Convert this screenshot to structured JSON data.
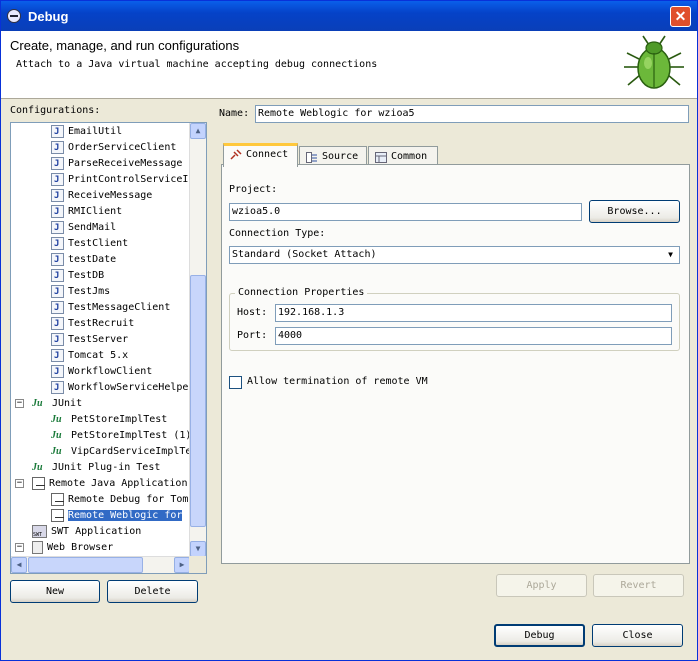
{
  "window": {
    "title": "Debug",
    "close_glyph": "✕"
  },
  "header": {
    "title": "Create, manage, and run configurations",
    "description": "Attach to a Java virtual machine accepting debug connections"
  },
  "left": {
    "configurations_label": "Configurations:",
    "tree_items": [
      {
        "label": "EmailUtil",
        "icon": "java-app-icon"
      },
      {
        "label": "OrderServiceClient",
        "icon": "java-app-icon"
      },
      {
        "label": "ParseReceiveMessage",
        "icon": "java-app-icon"
      },
      {
        "label": "PrintControlServiceI",
        "icon": "java-app-icon"
      },
      {
        "label": "ReceiveMessage",
        "icon": "java-app-icon"
      },
      {
        "label": "RMIClient",
        "icon": "java-app-icon"
      },
      {
        "label": "SendMail",
        "icon": "java-app-icon"
      },
      {
        "label": "TestClient",
        "icon": "java-app-icon"
      },
      {
        "label": "testDate",
        "icon": "java-app-icon"
      },
      {
        "label": "TestDB",
        "icon": "java-app-icon"
      },
      {
        "label": "TestJms",
        "icon": "java-app-icon"
      },
      {
        "label": "TestMessageClient",
        "icon": "java-app-icon"
      },
      {
        "label": "TestRecruit",
        "icon": "java-app-icon"
      },
      {
        "label": "TestServer",
        "icon": "java-app-icon"
      },
      {
        "label": "Tomcat 5.x",
        "icon": "java-app-icon"
      },
      {
        "label": "WorkflowClient",
        "icon": "java-app-icon"
      },
      {
        "label": "WorkflowServiceHelpe",
        "icon": "java-app-icon"
      },
      {
        "label": "JUnit",
        "icon": "junit-icon",
        "expander": "−"
      },
      {
        "label": "PetStoreImplTest",
        "icon": "junit-icon"
      },
      {
        "label": "PetStoreImplTest (1)",
        "icon": "junit-icon"
      },
      {
        "label": "VipCardServiceImplTe",
        "icon": "junit-icon"
      },
      {
        "label": "JUnit Plug-in Test",
        "icon": "junit-plugin-icon"
      },
      {
        "label": "Remote Java Application",
        "icon": "remote-java-icon",
        "expander": "−"
      },
      {
        "label": "Remote Debug for Tom",
        "icon": "remote-java-icon"
      },
      {
        "label": "Remote Weblogic for",
        "icon": "remote-java-icon",
        "selected": true
      },
      {
        "label": "SWT Application",
        "icon": "swt-icon"
      },
      {
        "label": "Web Browser",
        "icon": "web-browser-icon",
        "expander": "−"
      }
    ],
    "new_button": "New",
    "delete_button": "Delete"
  },
  "right": {
    "name_label": "Name:",
    "name_value": "Remote Weblogic for wzioa5",
    "tabs": [
      {
        "label": "Connect",
        "icon": "connect-icon",
        "active": true
      },
      {
        "label": "Source",
        "icon": "source-icon",
        "active": false
      },
      {
        "label": "Common",
        "icon": "common-icon",
        "active": false
      }
    ],
    "project_label": "Project:",
    "project_value": "wzioa5.0",
    "browse_button": "Browse...",
    "connection_type_label": "Connection Type:",
    "connection_type_value": "Standard (Socket Attach)",
    "connection_props_label": "Connection Properties",
    "host_label": "Host:",
    "host_value": "192.168.1.3",
    "port_label": "Port:",
    "port_value": "4000",
    "allow_termination_label": "Allow termination of remote VM",
    "allow_termination_checked": false,
    "apply_button": "Apply",
    "revert_button": "Revert"
  },
  "footer": {
    "debug_button": "Debug",
    "close_button": "Close"
  }
}
